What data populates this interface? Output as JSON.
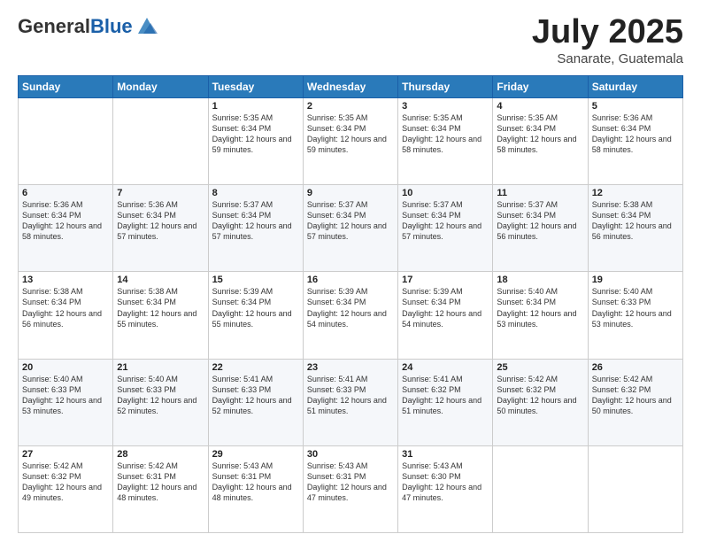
{
  "header": {
    "logo_general": "General",
    "logo_blue": "Blue",
    "month_title": "July 2025",
    "location": "Sanarate, Guatemala"
  },
  "days_of_week": [
    "Sunday",
    "Monday",
    "Tuesday",
    "Wednesday",
    "Thursday",
    "Friday",
    "Saturday"
  ],
  "weeks": [
    [
      {
        "day": "",
        "info": ""
      },
      {
        "day": "",
        "info": ""
      },
      {
        "day": "1",
        "info": "Sunrise: 5:35 AM\nSunset: 6:34 PM\nDaylight: 12 hours and 59 minutes."
      },
      {
        "day": "2",
        "info": "Sunrise: 5:35 AM\nSunset: 6:34 PM\nDaylight: 12 hours and 59 minutes."
      },
      {
        "day": "3",
        "info": "Sunrise: 5:35 AM\nSunset: 6:34 PM\nDaylight: 12 hours and 58 minutes."
      },
      {
        "day": "4",
        "info": "Sunrise: 5:35 AM\nSunset: 6:34 PM\nDaylight: 12 hours and 58 minutes."
      },
      {
        "day": "5",
        "info": "Sunrise: 5:36 AM\nSunset: 6:34 PM\nDaylight: 12 hours and 58 minutes."
      }
    ],
    [
      {
        "day": "6",
        "info": "Sunrise: 5:36 AM\nSunset: 6:34 PM\nDaylight: 12 hours and 58 minutes."
      },
      {
        "day": "7",
        "info": "Sunrise: 5:36 AM\nSunset: 6:34 PM\nDaylight: 12 hours and 57 minutes."
      },
      {
        "day": "8",
        "info": "Sunrise: 5:37 AM\nSunset: 6:34 PM\nDaylight: 12 hours and 57 minutes."
      },
      {
        "day": "9",
        "info": "Sunrise: 5:37 AM\nSunset: 6:34 PM\nDaylight: 12 hours and 57 minutes."
      },
      {
        "day": "10",
        "info": "Sunrise: 5:37 AM\nSunset: 6:34 PM\nDaylight: 12 hours and 57 minutes."
      },
      {
        "day": "11",
        "info": "Sunrise: 5:37 AM\nSunset: 6:34 PM\nDaylight: 12 hours and 56 minutes."
      },
      {
        "day": "12",
        "info": "Sunrise: 5:38 AM\nSunset: 6:34 PM\nDaylight: 12 hours and 56 minutes."
      }
    ],
    [
      {
        "day": "13",
        "info": "Sunrise: 5:38 AM\nSunset: 6:34 PM\nDaylight: 12 hours and 56 minutes."
      },
      {
        "day": "14",
        "info": "Sunrise: 5:38 AM\nSunset: 6:34 PM\nDaylight: 12 hours and 55 minutes."
      },
      {
        "day": "15",
        "info": "Sunrise: 5:39 AM\nSunset: 6:34 PM\nDaylight: 12 hours and 55 minutes."
      },
      {
        "day": "16",
        "info": "Sunrise: 5:39 AM\nSunset: 6:34 PM\nDaylight: 12 hours and 54 minutes."
      },
      {
        "day": "17",
        "info": "Sunrise: 5:39 AM\nSunset: 6:34 PM\nDaylight: 12 hours and 54 minutes."
      },
      {
        "day": "18",
        "info": "Sunrise: 5:40 AM\nSunset: 6:34 PM\nDaylight: 12 hours and 53 minutes."
      },
      {
        "day": "19",
        "info": "Sunrise: 5:40 AM\nSunset: 6:33 PM\nDaylight: 12 hours and 53 minutes."
      }
    ],
    [
      {
        "day": "20",
        "info": "Sunrise: 5:40 AM\nSunset: 6:33 PM\nDaylight: 12 hours and 53 minutes."
      },
      {
        "day": "21",
        "info": "Sunrise: 5:40 AM\nSunset: 6:33 PM\nDaylight: 12 hours and 52 minutes."
      },
      {
        "day": "22",
        "info": "Sunrise: 5:41 AM\nSunset: 6:33 PM\nDaylight: 12 hours and 52 minutes."
      },
      {
        "day": "23",
        "info": "Sunrise: 5:41 AM\nSunset: 6:33 PM\nDaylight: 12 hours and 51 minutes."
      },
      {
        "day": "24",
        "info": "Sunrise: 5:41 AM\nSunset: 6:32 PM\nDaylight: 12 hours and 51 minutes."
      },
      {
        "day": "25",
        "info": "Sunrise: 5:42 AM\nSunset: 6:32 PM\nDaylight: 12 hours and 50 minutes."
      },
      {
        "day": "26",
        "info": "Sunrise: 5:42 AM\nSunset: 6:32 PM\nDaylight: 12 hours and 50 minutes."
      }
    ],
    [
      {
        "day": "27",
        "info": "Sunrise: 5:42 AM\nSunset: 6:32 PM\nDaylight: 12 hours and 49 minutes."
      },
      {
        "day": "28",
        "info": "Sunrise: 5:42 AM\nSunset: 6:31 PM\nDaylight: 12 hours and 48 minutes."
      },
      {
        "day": "29",
        "info": "Sunrise: 5:43 AM\nSunset: 6:31 PM\nDaylight: 12 hours and 48 minutes."
      },
      {
        "day": "30",
        "info": "Sunrise: 5:43 AM\nSunset: 6:31 PM\nDaylight: 12 hours and 47 minutes."
      },
      {
        "day": "31",
        "info": "Sunrise: 5:43 AM\nSunset: 6:30 PM\nDaylight: 12 hours and 47 minutes."
      },
      {
        "day": "",
        "info": ""
      },
      {
        "day": "",
        "info": ""
      }
    ]
  ]
}
